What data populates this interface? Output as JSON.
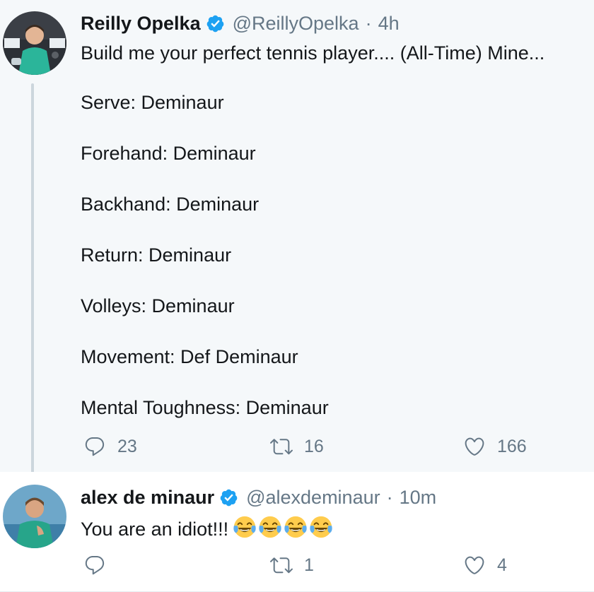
{
  "tweets": [
    {
      "author": {
        "display_name": "Reilly Opelka",
        "handle": "@ReillyOpelka",
        "verified": true,
        "avatar_icon": "avatar-photo"
      },
      "time": "4h",
      "separator": "·",
      "text": "Build me your perfect tennis player.... (All-Time) Mine...",
      "body_lines": [
        "Serve: Deminaur",
        "Forehand: Deminaur",
        "Backhand: Deminaur",
        "Return: Deminaur",
        "Volleys: Deminaur",
        "Movement: Def Deminaur",
        "Mental Toughness: Deminaur"
      ],
      "actions": {
        "reply_count": "23",
        "retweet_count": "16",
        "like_count": "166"
      }
    },
    {
      "author": {
        "display_name": "alex de minaur",
        "handle": "@alexdeminaur",
        "verified": true,
        "avatar_icon": "avatar-photo"
      },
      "time": "10m",
      "separator": "·",
      "text": "You are an idiot!!!",
      "emojis": [
        "face-with-tears-of-joy",
        "face-with-tears-of-joy",
        "face-with-tears-of-joy",
        "face-with-tears-of-joy"
      ],
      "actions": {
        "reply_count": "",
        "retweet_count": "1",
        "like_count": "4"
      }
    }
  ],
  "colors": {
    "highlighted_background": "#f5f8fa",
    "background": "#ffffff",
    "primary_text": "#14171a",
    "secondary_text": "#657786",
    "verified_blue": "#1da1f2",
    "thread_line": "#ccd6dd"
  },
  "icons": {
    "verified": "verified-badge-icon",
    "reply": "reply-icon",
    "retweet": "retweet-icon",
    "like": "heart-icon"
  }
}
